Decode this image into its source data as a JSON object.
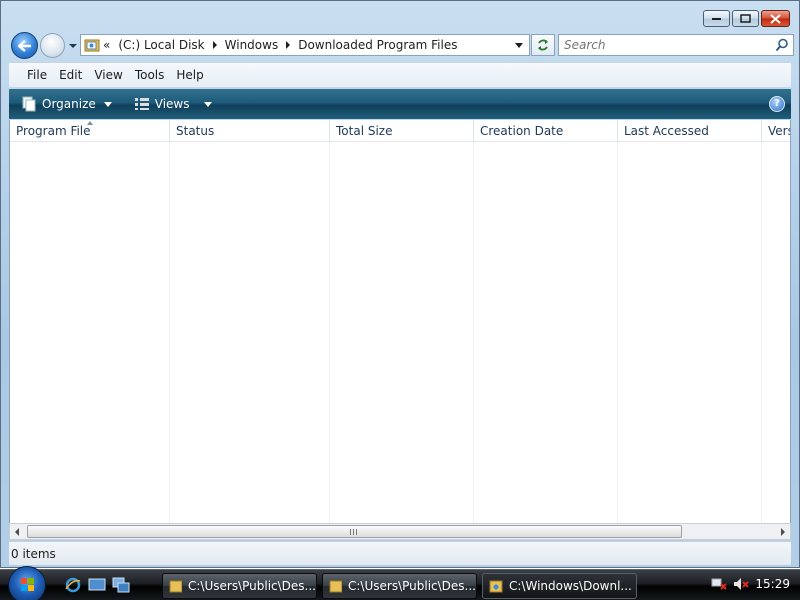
{
  "window": {
    "caption_buttons": [
      "minimize",
      "maximize",
      "close"
    ]
  },
  "nav": {
    "address": {
      "lead": "«",
      "crumbs": [
        "(C:) Local Disk",
        "Windows",
        "Downloaded Program Files"
      ]
    },
    "search_placeholder": "Search"
  },
  "menu": [
    "File",
    "Edit",
    "View",
    "Tools",
    "Help"
  ],
  "commandbar": {
    "organize": "Organize",
    "views": "Views"
  },
  "columns": [
    "Program File",
    "Status",
    "Total Size",
    "Creation Date",
    "Last Accessed",
    "Versi"
  ],
  "status": {
    "items": "0 items"
  },
  "taskbar": {
    "buttons": [
      "C:\\Users\\Public\\Des...",
      "C:\\Users\\Public\\Des...",
      "C:\\Windows\\Downl..."
    ],
    "clock": "15:29"
  },
  "colors": {
    "accent": "#1e5b7b",
    "close": "#c23a1f"
  }
}
